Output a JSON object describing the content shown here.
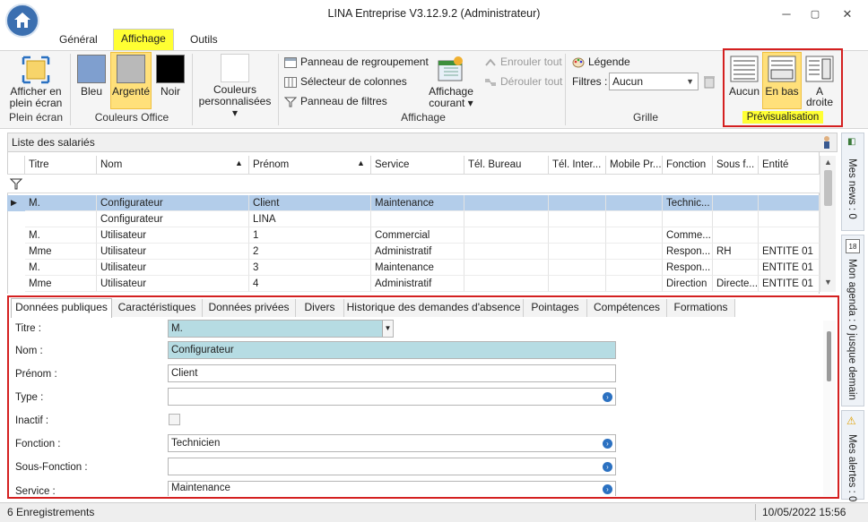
{
  "window": {
    "title": "LINA Entreprise  V3.12.9.2  (Administrateur)",
    "minimize": "─",
    "maximize": "▢",
    "close": "✕"
  },
  "ribbon_tabs": [
    {
      "label": "Général"
    },
    {
      "label": "Affichage"
    },
    {
      "label": "Outils"
    }
  ],
  "ribbon": {
    "plein_ecran": {
      "button_label_1": "Afficher en",
      "button_label_2": "plein écran",
      "group_title": "Plein écran"
    },
    "couleurs_office": {
      "group_title": "Couleurs Office",
      "items": [
        {
          "label": "Bleu",
          "color": "#7f9fcf"
        },
        {
          "label": "Argenté",
          "color": "#b9b9b9"
        },
        {
          "label": "Noir",
          "color": "#000000"
        }
      ]
    },
    "couleurs_perso": {
      "label_1": "Couleurs",
      "label_2": "personnalisées ▾"
    },
    "affichage": {
      "group_title": "Affichage",
      "panneau_regroupement": "Panneau de regroupement",
      "selecteur_colonnes": "Sélecteur de colonnes",
      "panneau_filtres": "Panneau de filtres",
      "affichage_courant_1": "Affichage",
      "affichage_courant_2": "courant ▾",
      "enrouler_tout": "Enrouler tout",
      "derouler_tout": "Dérouler tout"
    },
    "grille": {
      "group_title": "Grille",
      "legende": "Légende",
      "filtres_label": "Filtres :",
      "filtres_value": "Aucun"
    },
    "previsualisation": {
      "group_title": "Prévisualisation",
      "aucun": "Aucun",
      "en_bas": "En bas",
      "a_droite_1": "A",
      "a_droite_2": "droite"
    }
  },
  "grid": {
    "panel_title": "Liste des salariés",
    "columns": [
      "Titre",
      "Nom",
      "Prénom",
      "Service",
      "Tél. Bureau",
      "Tél. Inter...",
      "Mobile Pr...",
      "Fonction",
      "Sous f...",
      "Entité"
    ],
    "rows": [
      [
        "M.",
        "Configurateur",
        "Client",
        "Maintenance",
        "",
        "",
        "",
        "Technic...",
        "",
        ""
      ],
      [
        "",
        "Configurateur",
        "LINA",
        "",
        "",
        "",
        "",
        "",
        "",
        ""
      ],
      [
        "M.",
        "Utilisateur",
        "1",
        "Commercial",
        "",
        "",
        "",
        "Comme...",
        "",
        ""
      ],
      [
        "Mme",
        "Utilisateur",
        "2",
        "Administratif",
        "",
        "",
        "",
        "Respon...",
        "RH",
        "ENTITE 01"
      ],
      [
        "M.",
        "Utilisateur",
        "3",
        "Maintenance",
        "",
        "",
        "",
        "Respon...",
        "",
        "ENTITE 01"
      ],
      [
        "Mme",
        "Utilisateur",
        "4",
        "Administratif",
        "",
        "",
        "",
        "Direction",
        "Directe...",
        "ENTITE 01"
      ]
    ]
  },
  "detail_tabs": [
    {
      "label": "Données publiques"
    },
    {
      "label": "Caractéristiques"
    },
    {
      "label": "Données privées"
    },
    {
      "label": "Divers"
    },
    {
      "label": "Historique des demandes d'absence"
    },
    {
      "label": "Pointages"
    },
    {
      "label": "Compétences"
    },
    {
      "label": "Formations"
    }
  ],
  "detail_fields": {
    "titre": {
      "label": "Titre :",
      "value": "M."
    },
    "nom": {
      "label": "Nom :",
      "value": "Configurateur"
    },
    "prenom": {
      "label": "Prénom :",
      "value": "Client"
    },
    "type": {
      "label": "Type :",
      "value": ""
    },
    "inactif": {
      "label": "Inactif :"
    },
    "fonction": {
      "label": "Fonction :",
      "value": "Technicien"
    },
    "sous_fonction": {
      "label": "Sous-Fonction :",
      "value": ""
    },
    "service": {
      "label": "Service :",
      "value": "Maintenance"
    }
  },
  "side_panels": [
    {
      "label": "Mes news : 0"
    },
    {
      "label": "Mon agenda : 0 jusque demain",
      "badge": "18"
    },
    {
      "label": "Mes alertes : 0"
    }
  ],
  "status": {
    "records": "6 Enregistrements",
    "datetime": "10/05/2022 15:56"
  },
  "colors": {
    "highlight_yellow": "#ffff33",
    "annotation_red": "#d42020",
    "selection_blue": "#b3cdea"
  }
}
